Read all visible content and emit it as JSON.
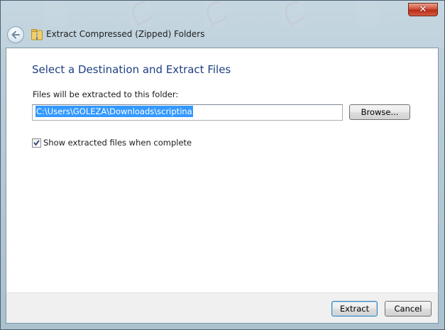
{
  "window": {
    "title": "Extract Compressed (Zipped) Folders",
    "close_glyph": "✕"
  },
  "page": {
    "heading": "Select a Destination and Extract Files",
    "folder_label": "Files will be extracted to this folder:",
    "destination_path": "C:\\Users\\GOLEZA\\Downloads\\scriptina",
    "browse_label": "Browse...",
    "show_files_label": "Show extracted files when complete",
    "show_files_checked": true
  },
  "footer": {
    "extract_label": "Extract",
    "cancel_label": "Cancel"
  },
  "icons": {
    "back": "back-arrow-icon",
    "title": "zipped-folder-icon",
    "close": "close-icon",
    "check": "checkmark-icon"
  },
  "colors": {
    "heading": "#1e3f80",
    "selection": "#3399ff",
    "close_button": "#c7442c"
  }
}
